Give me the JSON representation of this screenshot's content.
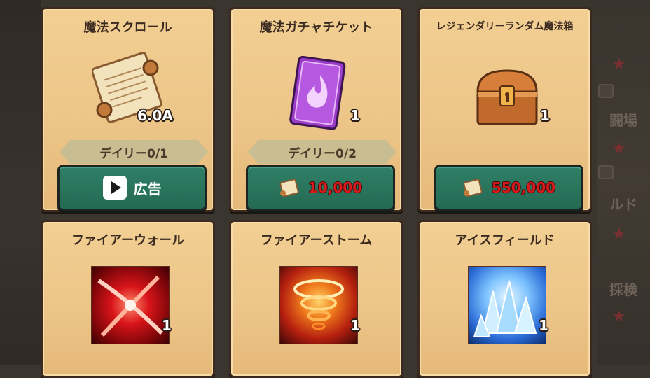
{
  "right_panel": {
    "labels": [
      "闘場",
      "ルド",
      "採検"
    ]
  },
  "cards": [
    {
      "title": "魔法スクロール",
      "icon": "scroll-icon",
      "quantity": "6.0A",
      "limit": "デイリー0/1",
      "button": {
        "type": "ad",
        "label": "広告",
        "icon": "play-icon"
      }
    },
    {
      "title": "魔法ガチャチケット",
      "icon": "gacha-ticket-icon",
      "quantity": "1",
      "limit": "デイリー0/2",
      "button": {
        "type": "price",
        "currency_icon": "scroll-icon",
        "price": "10,000"
      }
    },
    {
      "title": "レジェンダリーランダム魔法箱",
      "icon": "treasure-chest-icon",
      "quantity": "1",
      "button": {
        "type": "price",
        "currency_icon": "scroll-icon",
        "price": "550,000"
      }
    },
    {
      "title": "ファイアーウォール",
      "icon": "fire-wall-skill-icon",
      "quantity": "1"
    },
    {
      "title": "ファイアーストーム",
      "icon": "fire-storm-skill-icon",
      "quantity": "1"
    },
    {
      "title": "アイスフィールド",
      "icon": "ice-field-skill-icon",
      "quantity": "1"
    }
  ],
  "colors": {
    "card_bg": "#f0ca8e",
    "button_green": "#2a7560",
    "price_red": "#d51b1b",
    "ribbon": "#c9bd92"
  }
}
